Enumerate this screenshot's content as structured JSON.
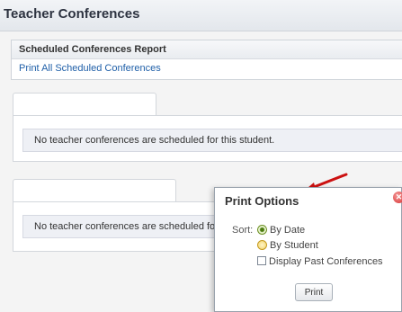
{
  "page": {
    "title": "Teacher Conferences"
  },
  "report": {
    "header": "Scheduled Conferences Report",
    "print_all_link": "Print All Scheduled Conferences"
  },
  "conference_panels": [
    {
      "message": "No teacher conferences are scheduled for this student."
    },
    {
      "message": "No teacher conferences are scheduled for this student."
    }
  ],
  "print_options": {
    "title": "Print Options",
    "sort_label": "Sort:",
    "sort_options": [
      {
        "label": "By Date",
        "selected": true
      },
      {
        "label": "By Student",
        "selected": false
      }
    ],
    "display_past_label": "Display Past Conferences",
    "display_past_checked": false,
    "print_button": "Print",
    "close_icon": "close-icon"
  },
  "annotation": {
    "arrow_color": "#cc1111"
  }
}
